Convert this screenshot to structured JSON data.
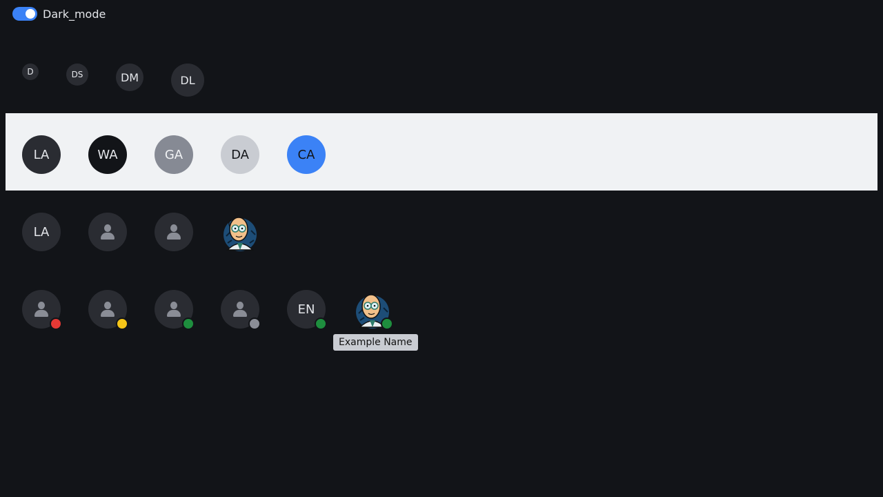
{
  "dark_mode_toggle": {
    "label": "Dark_mode",
    "state": "on"
  },
  "size_row": {
    "avatars": [
      "D",
      "DS",
      "DM",
      "DL"
    ]
  },
  "color_row": {
    "avatars": [
      "LA",
      "WA",
      "GA",
      "DA",
      "CA"
    ]
  },
  "type_row": {
    "letters_avatar": "LA",
    "icon_avatars": [
      "person-icon",
      "person-icon"
    ],
    "image_avatar": "professor-image"
  },
  "status_row": {
    "avatars": [
      {
        "content": "person-icon",
        "status_color": "#e53935"
      },
      {
        "content": "person-icon",
        "status_color": "#f5c518"
      },
      {
        "content": "person-icon",
        "status_color": "#1e8e3e"
      },
      {
        "content": "person-icon",
        "status_color": "#8a8d96"
      },
      {
        "content": "EN",
        "status_color": "#1e8e3e"
      },
      {
        "content": "professor-image",
        "status_color": "#1e8e3e"
      }
    ]
  },
  "tooltip": {
    "text": "Example Name"
  },
  "colors": {
    "accent": "#3b82f6",
    "background": "#121418",
    "light_band": "#f0f2f4"
  }
}
